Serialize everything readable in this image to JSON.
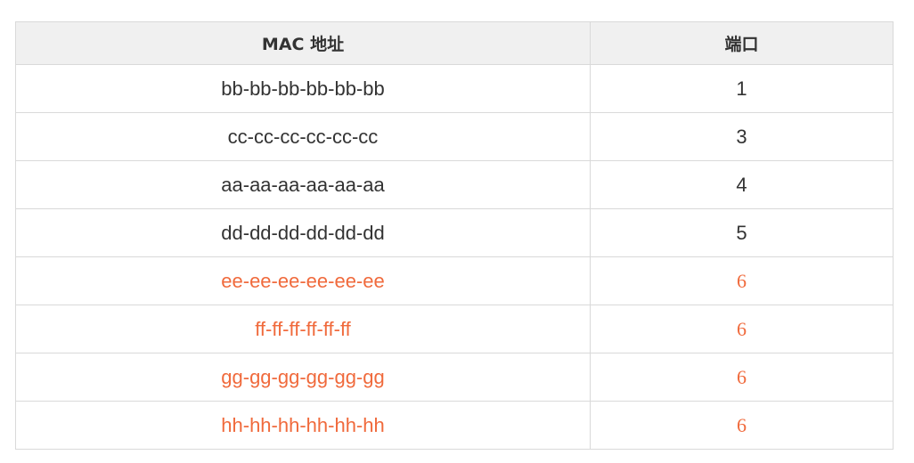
{
  "table": {
    "headers": {
      "mac": "MAC 地址",
      "port": "端口"
    },
    "rows": [
      {
        "mac": "bb-bb-bb-bb-bb-bb",
        "port": "1",
        "highlighted": false
      },
      {
        "mac": "cc-cc-cc-cc-cc-cc",
        "port": "3",
        "highlighted": false
      },
      {
        "mac": "aa-aa-aa-aa-aa-aa",
        "port": "4",
        "highlighted": false
      },
      {
        "mac": "dd-dd-dd-dd-dd-dd",
        "port": "5",
        "highlighted": false
      },
      {
        "mac": "ee-ee-ee-ee-ee-ee",
        "port": "6",
        "highlighted": true
      },
      {
        "mac": "ff-ff-ff-ff-ff-ff",
        "port": "6",
        "highlighted": true
      },
      {
        "mac": "gg-gg-gg-gg-gg-gg",
        "port": "6",
        "highlighted": true
      },
      {
        "mac": "hh-hh-hh-hh-hh-hh",
        "port": "6",
        "highlighted": true
      }
    ]
  },
  "colors": {
    "text": "#333333",
    "highlight": "#f06a3c",
    "header_bg": "#f0f0f0",
    "border": "#d9d9d9"
  }
}
